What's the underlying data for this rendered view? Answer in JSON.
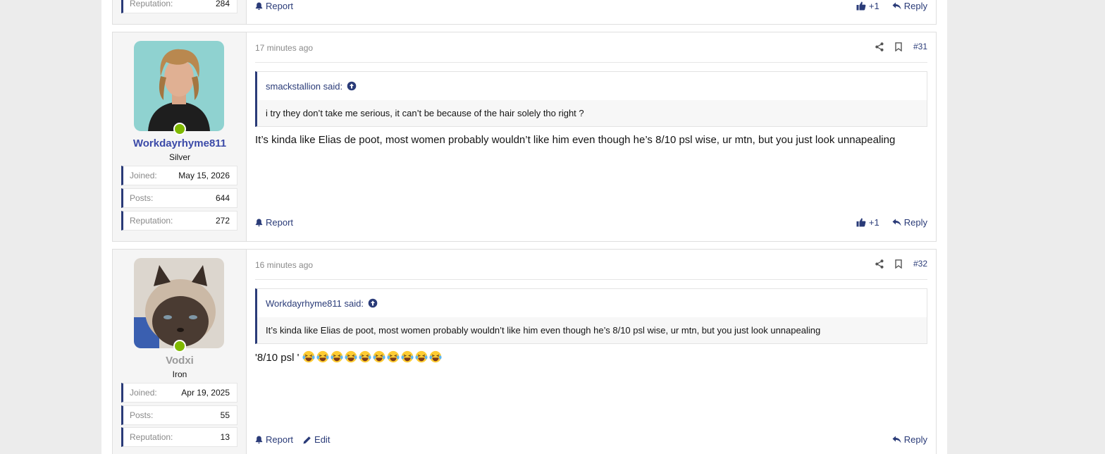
{
  "top_post": {
    "stat_label": "Reputation:",
    "stat_value": "284",
    "report_label": "Report",
    "like_count": "+1",
    "reply_label": "Reply"
  },
  "posts": [
    {
      "username": "Workdayrhyme811",
      "username_color": "#3b4aa8",
      "rank": "Silver",
      "stats": [
        {
          "label": "Joined:",
          "value": "May 15, 2026"
        },
        {
          "label": "Posts:",
          "value": "644"
        },
        {
          "label": "Reputation:",
          "value": "272"
        }
      ],
      "time": "17 minutes ago",
      "post_number": "#31",
      "quote_author": "smackstallion said:",
      "quote_text": "i try they don’t take me serious, it can’t be because of the hair solely tho right ?",
      "body": "It’s kinda like Elias de poot, most women probably wouldn’t like him even though he’s 8/10 psl wise, ur mtn, but you just look unnapealing",
      "report_label": "Report",
      "like_count": "+1",
      "reply_label": "Reply"
    },
    {
      "username": "Vodxi",
      "username_color": "#9a9a9a",
      "rank": "Iron",
      "stats": [
        {
          "label": "Joined:",
          "value": "Apr 19, 2025"
        },
        {
          "label": "Posts:",
          "value": "55"
        },
        {
          "label": "Reputation:",
          "value": "13"
        }
      ],
      "time": "16 minutes ago",
      "post_number": "#32",
      "quote_author": "Workdayrhyme811 said:",
      "quote_text": "It’s kinda like Elias de poot, most women probably wouldn’t like him even though he’s 8/10 psl wise, ur mtn, but you just look unnapealing",
      "body": "'8/10 psl '",
      "emoji_count": 10,
      "report_label": "Report",
      "edit_label": "Edit",
      "reply_label": "Reply"
    }
  ],
  "colors": {
    "accent": "#2a3b78",
    "online": "#7fb900",
    "background": "#ececec"
  }
}
